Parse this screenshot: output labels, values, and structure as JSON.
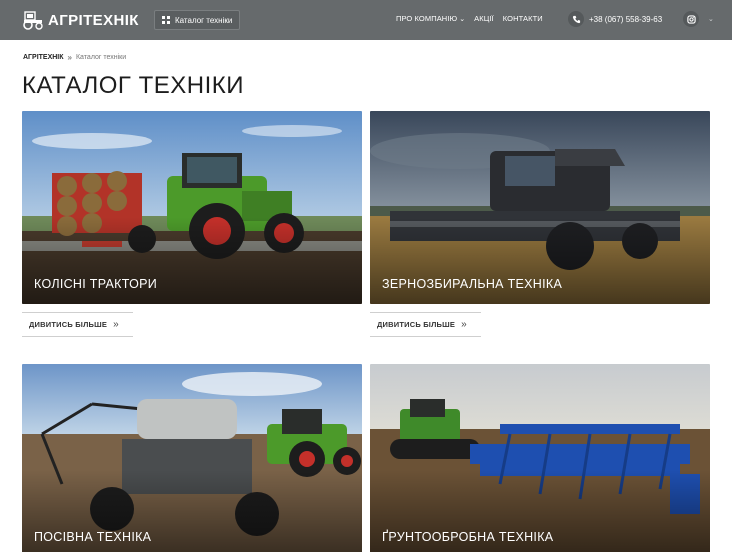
{
  "header": {
    "logo_text": "АГРІТЕХНІК",
    "catalog_button": "Каталог техніки",
    "nav": [
      {
        "label": "ПРО КОМПАНІЮ",
        "has_dropdown": true
      },
      {
        "label": "АКЦІЇ",
        "has_dropdown": false
      },
      {
        "label": "КОНТАКТИ",
        "has_dropdown": false
      }
    ],
    "phone": "+38 (067) 558-39-63",
    "social_icon": "instagram-icon"
  },
  "breadcrumb": {
    "home": "АГРІТЕХНІК",
    "separator": "»",
    "current": "Каталог техніки"
  },
  "page_title": "КАТАЛОГ ТЕХНІКИ",
  "cards": [
    {
      "label": "КОЛІСНІ ТРАКТОРИ",
      "more": "ДИВИТИСЬ БІЛЬШЕ"
    },
    {
      "label": "ЗЕРНОЗБИРАЛЬНА ТЕХНІКА",
      "more": "ДИВИТИСЬ БІЛЬШЕ"
    },
    {
      "label": "ПОСІВНА ТЕХНІКА"
    },
    {
      "label": "ҐРУНТООБРОБНА ТЕХНІКА"
    }
  ],
  "colors": {
    "header_bg": "#666a6c",
    "fendt_green": "#4c9a2a",
    "lemken_blue": "#1e4fb0"
  }
}
